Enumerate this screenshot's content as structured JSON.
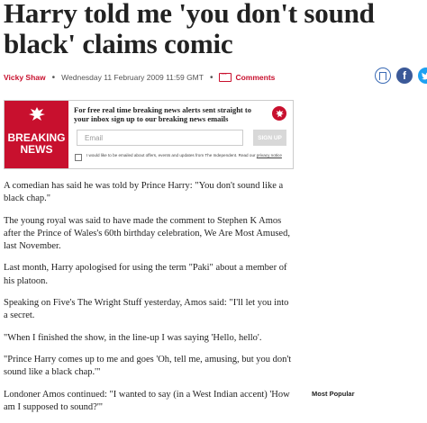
{
  "article": {
    "headline": "Harry told me 'you don't sound black' claims comic",
    "author": "Vicky Shaw",
    "date": "Wednesday 11 February 2009 11:59 GMT",
    "comments_label": "Comments",
    "paragraphs": [
      "A comedian has said he was told by Prince Harry: \"You don't sound like a black chap.\"",
      "The young royal was said to have made the comment to Stephen K Amos after the Prince of Wales's 60th birthday celebration, We Are Most Amused, last November.",
      "Last month, Harry apologised for using the term \"Paki\" about a member of his platoon.",
      "Speaking on Five's The Wright Stuff yesterday, Amos said: \"I'll let you into a secret.",
      "\"When I finished the show, in the line-up I was saying 'Hello, hello'.",
      "\"Prince Harry comes up to me and goes 'Oh, tell me, amusing, but you don't sound like a black chap.'\"",
      "Londoner Amos continued: \"I wanted to say (in a West Indian accent) 'How am I supposed to sound?'\""
    ]
  },
  "share": {
    "icons": [
      "bookmark-icon",
      "facebook-icon",
      "twitter-icon"
    ],
    "facebook_glyph": "f"
  },
  "promo": {
    "badge_line1": "BREAKING",
    "badge_line2": "NEWS",
    "headline": "For free real time breaking news alerts sent straight to your inbox sign up to our breaking news emails",
    "email_placeholder": "Email",
    "signup_label": "SIGN UP",
    "consent_text": "I would like to be emailed about offers, events and updates from The Independent. Read our",
    "privacy_link": "privacy notice"
  },
  "sidebar": {
    "most_popular_label": "Most Popular"
  },
  "colors": {
    "brand_red": "#c8102e",
    "facebook_blue": "#3b5998",
    "twitter_blue": "#1da1f2"
  }
}
